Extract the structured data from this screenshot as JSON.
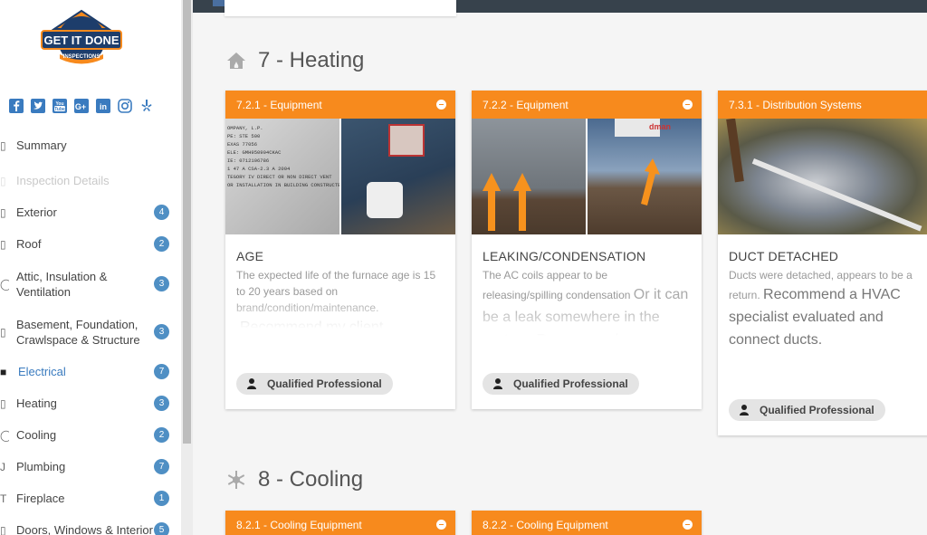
{
  "brand": {
    "logo_text": "GET IT DONE",
    "logo_sub": "INSPECTIONS"
  },
  "socials": [
    "facebook-icon",
    "twitter-icon",
    "youtube-icon",
    "google-plus-icon",
    "linkedin-icon",
    "instagram-icon",
    "yelp-icon"
  ],
  "sidebar": {
    "items": [
      {
        "label": "Summary",
        "badge": null
      },
      {
        "label": "Inspection Details",
        "badge": null
      },
      {
        "label": "Exterior",
        "badge": "4"
      },
      {
        "label": "Roof",
        "badge": "2"
      },
      {
        "label": "Attic, Insulation &",
        "label2": "Ventilation",
        "badge": "3"
      },
      {
        "label": "Basement, Foundation,",
        "label2": "Crawlspace & Structure",
        "badge": "3"
      },
      {
        "label": "Electrical",
        "badge": "7"
      },
      {
        "label": "Heating",
        "badge": "3"
      },
      {
        "label": "Cooling",
        "badge": "2"
      },
      {
        "label": "Plumbing",
        "badge": "7"
      },
      {
        "label": "Fireplace",
        "badge": "1"
      },
      {
        "label": "Doors, Windows & Interior",
        "badge": "5"
      }
    ]
  },
  "sections": {
    "heating": {
      "title": "7 - Heating"
    },
    "cooling": {
      "title": "8 - Cooling"
    }
  },
  "cards": [
    {
      "header": "7.2.1 - Equipment",
      "title": "AGE",
      "body_small": "The expected life of the furnace age is 15 to 20 years based on brand/condition/maintenance.",
      "body_big": "Recommend my client",
      "pill": "Qualified Professional",
      "photo_text": [
        "OMPANY, L.P.",
        "PE: STE 500",
        "EXAS 77056",
        "ELE: GMH950904CKAC",
        "IE: 0712106786",
        "1 47 A   CSA-2.3 A 2004",
        "TEGORY IV DIRECT OR NON DIRECT VENT",
        "OR INSTALLATION IN BUILDING CONSTRUCTED"
      ]
    },
    {
      "header": "7.2.2 - Equipment",
      "title": "LEAKING/CONDENSATION",
      "body_small": "The AC coils appear to be releasing/spilling condensation",
      "body_big": "Or it can be a leak somewhere in the system. Recommend a",
      "pill": "Qualified Professional",
      "photo_text": [
        "dman"
      ]
    },
    {
      "header": "7.3.1 - Distribution Systems",
      "title": "DUCT DETACHED",
      "body_small": "Ducts were detached, appears to be a return.",
      "body_big": "Recommend a HVAC specialist evaluated and connect ducts.",
      "pill": "Qualified Professional"
    },
    {
      "header": "8.2.1 - Cooling Equipment"
    },
    {
      "header": "8.2.2 - Cooling Equipment"
    }
  ],
  "colors": {
    "accent": "#f78a1d",
    "badge": "#4f8fc4",
    "topbar": "#37424c"
  }
}
